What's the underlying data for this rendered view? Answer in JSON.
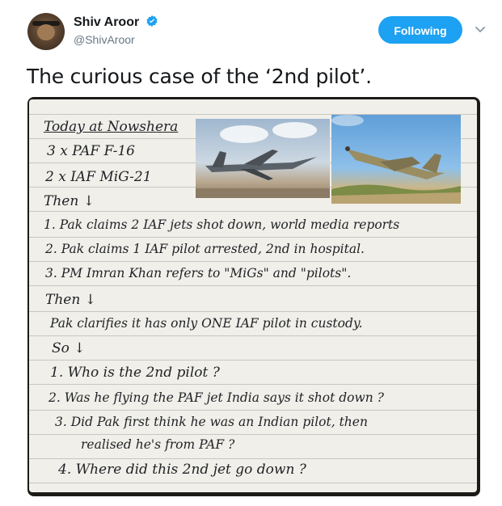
{
  "tweet": {
    "display_name": "Shiv Aroor",
    "handle": "@ShivAroor",
    "follow_label": "Following",
    "text": "The curious case of the ‘2nd pilot’."
  },
  "colors": {
    "accent": "#1da1f2",
    "verified": "#1da1f2",
    "text": "#14171a",
    "muted": "#657786"
  },
  "note": {
    "lines": [
      "Today at Nowshera",
      "3 x PAF F-16",
      "2 x IAF MiG-21",
      "Then ↓",
      "1. Pak claims 2 IAF jets shot down, world media reports",
      "2. Pak claims 1 IAF pilot arrested, 2nd in hospital.",
      "3. PM Imran Khan refers to \"MiGs\" and \"pilots\".",
      "Then ↓",
      "Pak clarifies it has only ONE IAF pilot in custody.",
      "So ↓",
      "1. Who is the 2nd pilot ?",
      "2. Was he flying the PAF jet India says it shot down ?",
      "3. Did Pak first think he was an Indian pilot, then",
      "realised he's from PAF ?",
      "4. Where did this 2nd jet go down ?"
    ],
    "photos": [
      "f16-jet-photo",
      "mig21-jet-photo"
    ]
  }
}
